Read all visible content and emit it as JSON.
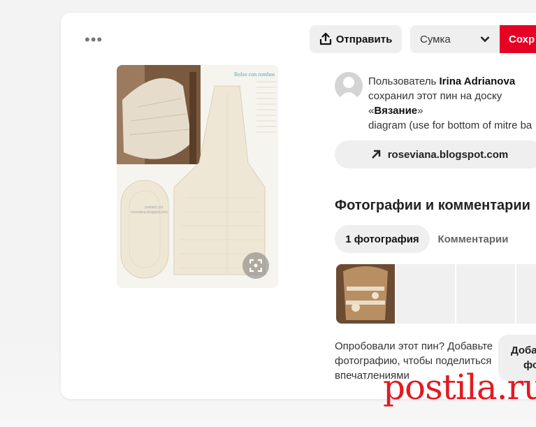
{
  "toolbar": {
    "more_label": "•••",
    "send_label": "Отправить",
    "board_select_value": "Сумка",
    "save_label": "Сохр"
  },
  "pin": {
    "saved_prefix": "Пользователь ",
    "user_name": "Irina Adrianova",
    "saved_line2": "сохранил этот пин на доску",
    "board_open_quote": "«",
    "board_name": "Вязание",
    "board_close_quote": "»",
    "description": "diagram (use for bottom of mitre ba",
    "link_label": "roseviana.blogspot.com"
  },
  "photos_section": {
    "title": "Фотографии и комментарии",
    "tab_photos": "1 фотография",
    "tab_comments": "Комментарии",
    "try_text": "Опробовали этот пин? Добавьте фотографию, чтобы поделиться впечатлениями",
    "add_label_line1": "Доба",
    "add_label_line2": "фо"
  },
  "pin_image_text": {
    "heading": "Bolso con rombos",
    "watermark_1": "postado por",
    "watermark_2": "roseviana.blogspot.com"
  },
  "watermark": "postila.ru",
  "colors": {
    "save_red": "#e60023",
    "watermark_red": "#e21a22"
  }
}
